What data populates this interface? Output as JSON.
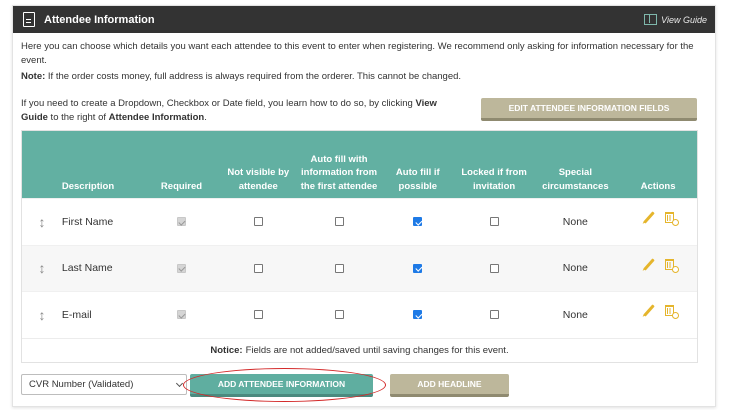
{
  "header": {
    "title": "Attendee Information",
    "guide_link": "View Guide"
  },
  "intro": {
    "line1": "Here you can choose which details you want each attendee to this event to enter when registering. We recommend only asking for information necessary for the event.",
    "note_label": "Note:",
    "note_text": " If the order costs money, full address is always required from the orderer. This cannot be changed."
  },
  "create": {
    "text_pre": "If you need to create a Dropdown, Checkbox or Date field, you learn how to do so, by clicking ",
    "view_guide": "View Guide",
    "text_mid": " to the right of ",
    "attendee_info": "Attendee Information",
    "text_end": "."
  },
  "edit_fields_button": "EDIT ATTENDEE INFORMATION FIELDS",
  "table": {
    "columns": {
      "description": "Description",
      "required": "Required",
      "not_visible": "Not visible by attendee",
      "autofill_first": "Auto fill with information from the first attendee",
      "autofill_possible": "Auto fill if possible",
      "locked": "Locked if from invitation",
      "special": "Special circumstances",
      "actions": "Actions"
    },
    "rows": [
      {
        "description": "First Name",
        "required": true,
        "not_visible": false,
        "autofill_first": false,
        "autofill_possible": true,
        "locked": false,
        "special": "None"
      },
      {
        "description": "Last Name",
        "required": true,
        "not_visible": false,
        "autofill_first": false,
        "autofill_possible": true,
        "locked": false,
        "special": "None"
      },
      {
        "description": "E-mail",
        "required": true,
        "not_visible": false,
        "autofill_first": false,
        "autofill_possible": true,
        "locked": false,
        "special": "None"
      }
    ]
  },
  "notice": {
    "label": "Notice:",
    "text": "Fields are not added/saved until saving changes for this event."
  },
  "footer": {
    "select_value": "CVR Number (Validated)",
    "add_info_button": "ADD ATTENDEE INFORMATION",
    "add_headline_button": "ADD HEADLINE"
  },
  "colors": {
    "header_bg": "#333333",
    "table_header": "#62b0a2",
    "teal_button": "#5faea0",
    "tan_button": "#bdb79b",
    "checkbox_checked": "#1e7ae6",
    "action_icon": "#e5b52c",
    "highlight": "#d32a2a"
  }
}
